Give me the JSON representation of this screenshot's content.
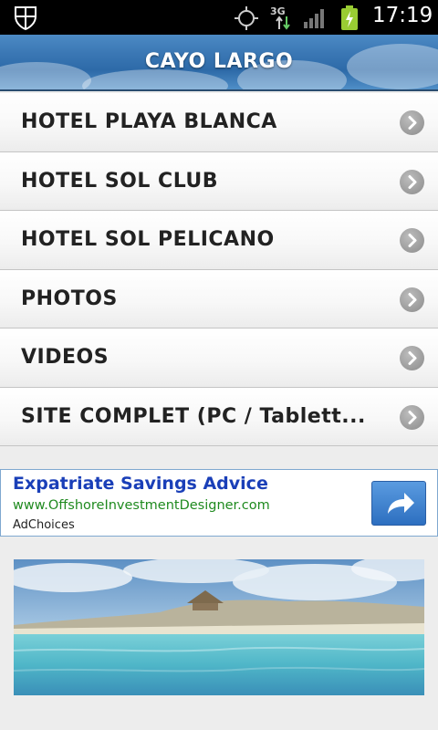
{
  "status_bar": {
    "time": "17:19",
    "icons": [
      "shield-icon",
      "gps-icon",
      "3g-icon",
      "signal-icon",
      "battery-charging-icon"
    ],
    "network_label": "3G"
  },
  "header": {
    "title": "CAYO LARGO"
  },
  "menu": {
    "items": [
      {
        "label": "HOTEL PLAYA BLANCA"
      },
      {
        "label": "HOTEL SOL CLUB"
      },
      {
        "label": "HOTEL SOL PELICANO"
      },
      {
        "label": "PHOTOS"
      },
      {
        "label": "VIDEOS"
      },
      {
        "label": "SITE COMPLET (PC / Tablett..."
      }
    ]
  },
  "ad": {
    "title": "Expatriate Savings Advice",
    "url": "www.OffshoreInvestmentDesigner.com",
    "choices": "AdChoices",
    "button_icon": "share-arrow-icon"
  },
  "colors": {
    "header_blue": "#3a77b4",
    "ad_title": "#1a3fb8",
    "ad_url": "#1f8a1f",
    "chevron_gray": "#9a9a9a"
  }
}
